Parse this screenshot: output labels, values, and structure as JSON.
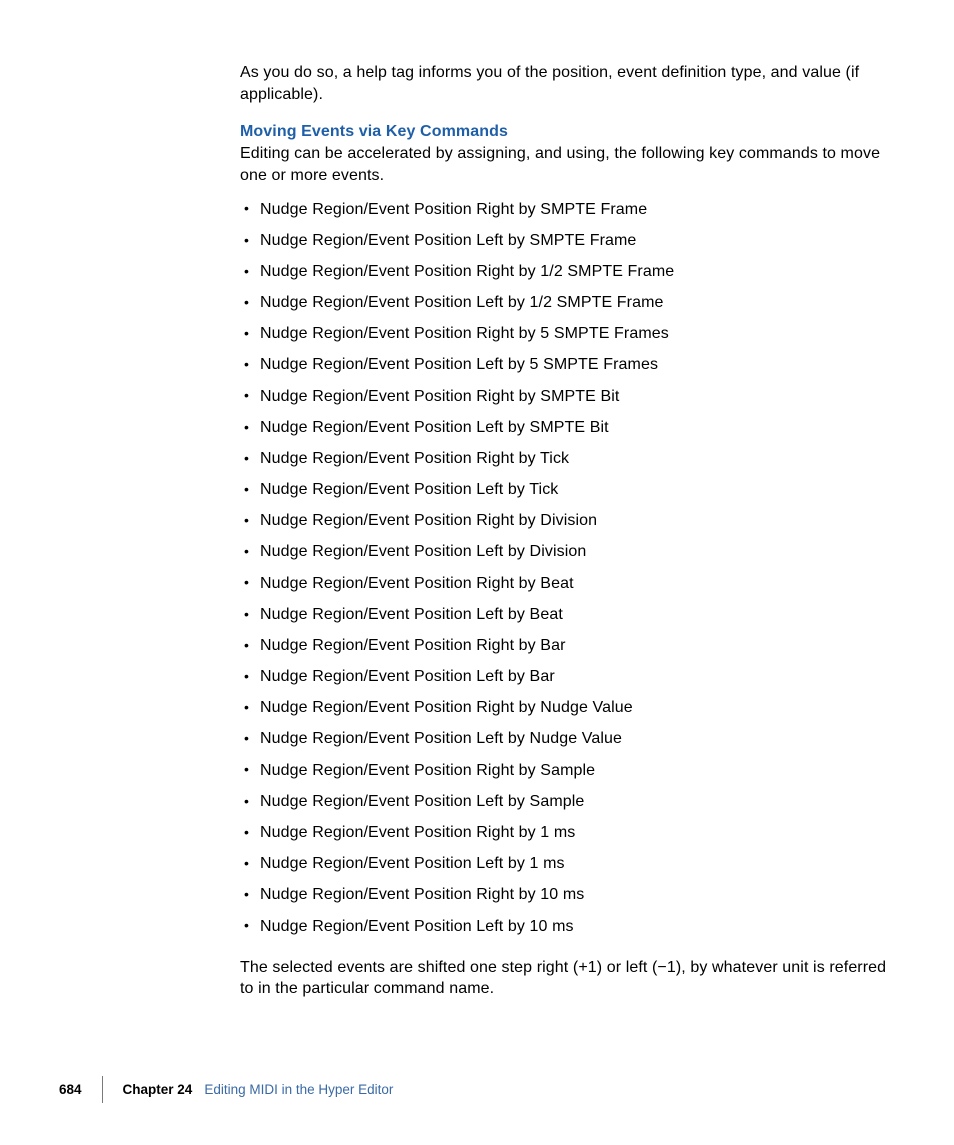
{
  "paragraphs": {
    "intro": "As you do so, a help tag informs you of the position, event definition type, and value (if applicable).",
    "heading": "Moving Events via Key Commands",
    "subintro": "Editing can be accelerated by assigning, and using, the following key commands to move one or more events.",
    "outro": "The selected events are shifted one step right (+1) or left (−1), by whatever unit is referred to in the particular command name."
  },
  "bullets": [
    "Nudge Region/Event Position Right by SMPTE Frame",
    "Nudge Region/Event Position Left by SMPTE Frame",
    "Nudge Region/Event Position Right by 1/2 SMPTE Frame",
    "Nudge Region/Event Position Left by 1/2 SMPTE Frame",
    "Nudge Region/Event Position Right by 5 SMPTE Frames",
    "Nudge Region/Event Position Left by 5 SMPTE Frames",
    "Nudge Region/Event Position Right by SMPTE Bit",
    "Nudge Region/Event Position Left by SMPTE Bit",
    "Nudge Region/Event Position Right by Tick",
    "Nudge Region/Event Position Left by Tick",
    "Nudge Region/Event Position Right by Division",
    "Nudge Region/Event Position Left by Division",
    "Nudge Region/Event Position Right by Beat",
    "Nudge Region/Event Position Left by Beat",
    "Nudge Region/Event Position Right by Bar",
    "Nudge Region/Event Position Left by Bar",
    "Nudge Region/Event Position Right by Nudge Value",
    "Nudge Region/Event Position Left by Nudge Value",
    "Nudge Region/Event Position Right by Sample",
    "Nudge Region/Event Position Left by Sample",
    "Nudge Region/Event Position Right by 1 ms",
    "Nudge Region/Event Position Left by 1 ms",
    "Nudge Region/Event Position Right by 10 ms",
    "Nudge Region/Event Position Left by 10 ms"
  ],
  "footer": {
    "page_number": "684",
    "chapter_label": "Chapter 24",
    "chapter_title": "Editing MIDI in the Hyper Editor"
  }
}
